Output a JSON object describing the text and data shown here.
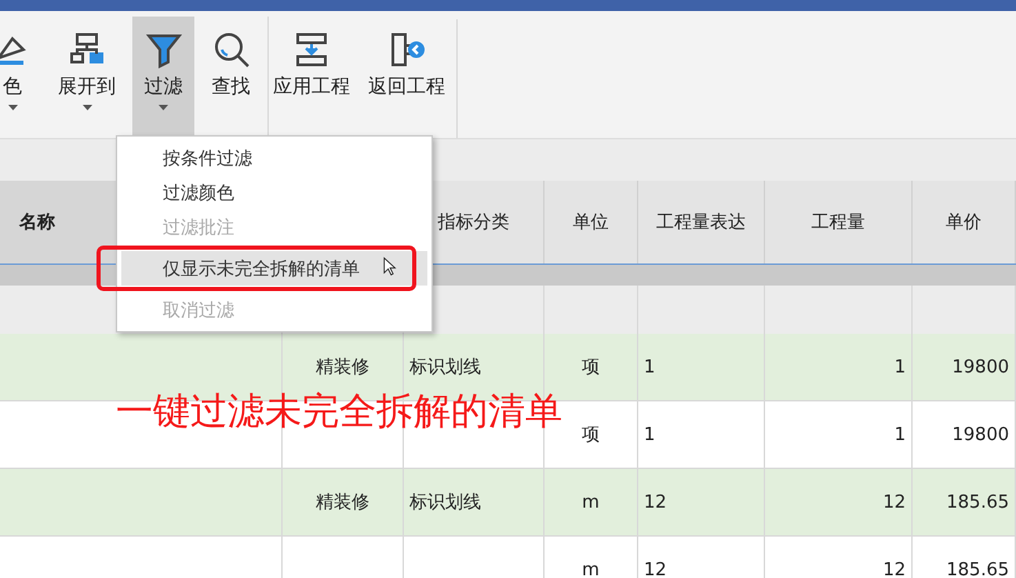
{
  "toolbar": {
    "buttons": [
      {
        "label": "色",
        "kind": "paint",
        "has_dropdown": true,
        "selected": false,
        "group_start": false
      },
      {
        "label": "展开到",
        "kind": "tree",
        "has_dropdown": true,
        "selected": false,
        "group_start": false
      },
      {
        "label": "过滤",
        "kind": "filter",
        "has_dropdown": true,
        "selected": true,
        "group_start": false
      },
      {
        "label": "查找",
        "kind": "search",
        "has_dropdown": false,
        "selected": false,
        "group_start": false
      },
      {
        "label": "应用工程",
        "kind": "apply",
        "has_dropdown": false,
        "selected": false,
        "group_start": true
      },
      {
        "label": "返回工程",
        "kind": "return",
        "has_dropdown": false,
        "selected": false,
        "group_start": false
      }
    ]
  },
  "filter_menu": {
    "items": [
      {
        "label": "按条件过滤",
        "disabled": false,
        "selected": false
      },
      {
        "label": "过滤颜色",
        "disabled": false,
        "selected": false
      },
      {
        "label": "过滤批注",
        "disabled": true,
        "selected": false
      },
      {
        "label": "仅显示未完全拆解的清单",
        "disabled": false,
        "selected": true
      },
      {
        "label": "取消过滤",
        "disabled": true,
        "selected": false
      }
    ]
  },
  "table": {
    "columns": [
      "名称",
      "",
      "指标分类",
      "单位",
      "工程量表达",
      "工程量",
      "单价"
    ],
    "rows": [
      {
        "highlighted": true,
        "cells": [
          "",
          "精装修",
          "标识划线",
          "项",
          "1",
          "1",
          "19800"
        ]
      },
      {
        "highlighted": false,
        "cells": [
          "",
          "",
          "",
          "项",
          "1",
          "1",
          "19800"
        ]
      },
      {
        "highlighted": true,
        "cells": [
          "",
          "精装修",
          "标识划线",
          "m",
          "12",
          "12",
          "185.65"
        ]
      },
      {
        "highlighted": false,
        "cells": [
          "",
          "",
          "",
          "m",
          "12",
          "12",
          "185.65"
        ]
      }
    ]
  },
  "caption": "一键过滤未完全拆解的清单"
}
